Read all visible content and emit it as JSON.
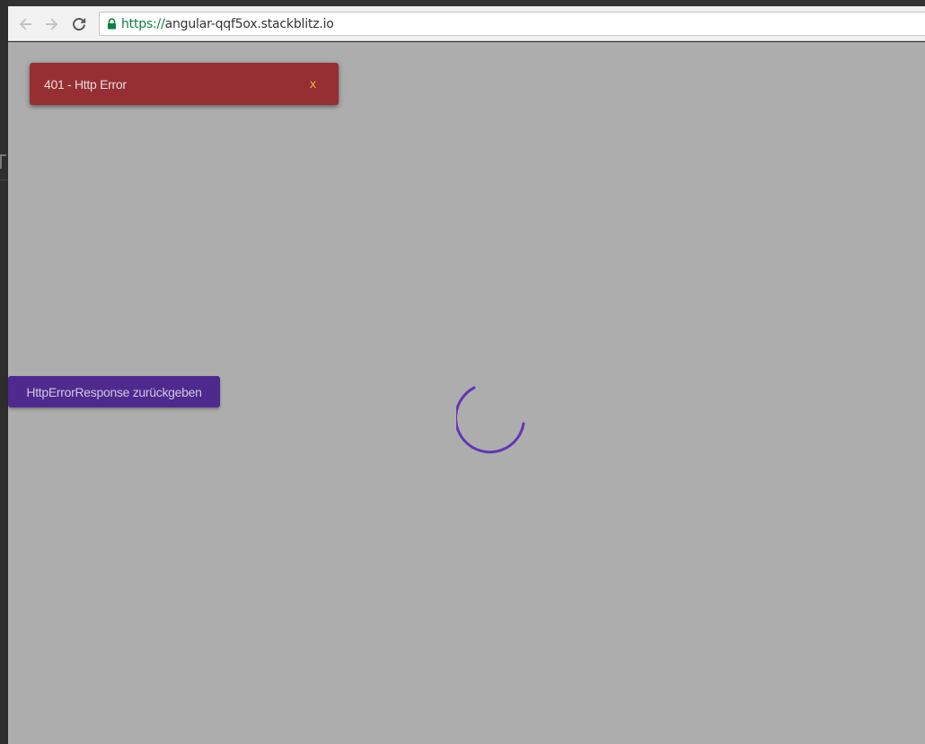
{
  "browser": {
    "url_scheme": "https://",
    "url_host": "angular-qqf5ox.stackblitz.io",
    "icons": {
      "back": "arrow-left-icon",
      "forward": "arrow-right-icon",
      "reload": "reload-icon",
      "lock": "lock-icon"
    }
  },
  "toast": {
    "message": "401 - Http Error",
    "close_label": "x",
    "colors": {
      "background": "#962f33",
      "close": "#ecb94a"
    }
  },
  "action_button": {
    "label": "HttpErrorResponse zurückgeben",
    "color": "#4e2a8e"
  },
  "spinner": {
    "color": "#6236b5",
    "state": "loading"
  },
  "overlay": {
    "color": "#adadad"
  }
}
